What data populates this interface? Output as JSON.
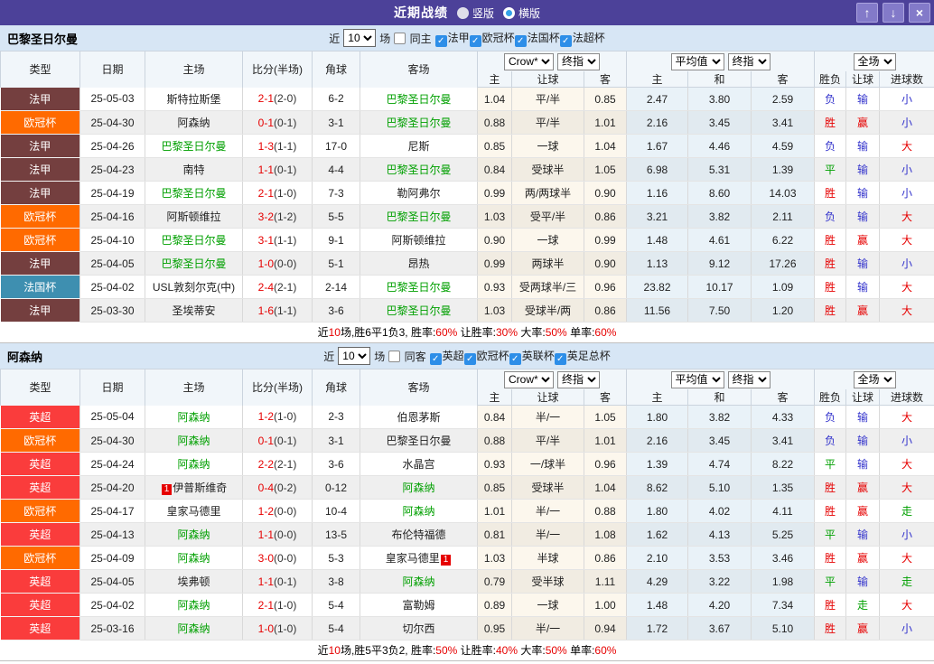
{
  "titlebar": {
    "title": "近期战绩",
    "radios": [
      {
        "label": "竖版",
        "style": "filled"
      },
      {
        "label": "横版",
        "style": "ring"
      }
    ],
    "buttons": {
      "up": "↑",
      "down": "↓",
      "close": "×"
    }
  },
  "table_header": {
    "main": [
      "类型",
      "日期",
      "主场",
      "比分(半场)",
      "角球",
      "客场"
    ],
    "sub": [
      "主",
      "让球",
      "客",
      "主",
      "和",
      "客",
      "胜负",
      "让球",
      "进球数"
    ],
    "selects": {
      "asia_source": "Crow*",
      "asia_index": "终指",
      "euro_source": "平均值",
      "euro_index": "终指",
      "scope": "全场"
    }
  },
  "league_colors": {
    "法甲": "#743F3F",
    "欧冠杯": "#FF6A00",
    "法国杯": "#3E8FB0",
    "英超": "#FA3C3C"
  },
  "outcome_colors": {
    "胜": "#E60000",
    "平": "#00A000",
    "负": "#3333CC",
    "赢": "#E60000",
    "输": "#3333CC",
    "走": "#00A000",
    "大": "#E60000",
    "小": "#3333CC"
  },
  "sections": [
    {
      "team": "巴黎圣日尔曼",
      "filter": {
        "near": "近",
        "count": "10",
        "unit": "场",
        "same": {
          "label": "同主",
          "checked": false
        },
        "leagues": [
          {
            "label": "法甲",
            "checked": true
          },
          {
            "label": "欧冠杯",
            "checked": true
          },
          {
            "label": "法国杯",
            "checked": true
          },
          {
            "label": "法超杯",
            "checked": true
          }
        ]
      },
      "rows": [
        {
          "league": "法甲",
          "date": "25-05-03",
          "home": "斯特拉斯堡",
          "home_team": false,
          "score": "2-1",
          "half": "(2-0)",
          "corner": "6-2",
          "away": "巴黎圣日尔曼",
          "away_team": true,
          "odds": [
            "1.04",
            "平/半",
            "0.85",
            "2.47",
            "3.80",
            "2.59"
          ],
          "result": "负",
          "let": "输",
          "goal": "小"
        },
        {
          "league": "欧冠杯",
          "date": "25-04-30",
          "home": "阿森纳",
          "home_team": false,
          "score": "0-1",
          "half": "(0-1)",
          "corner": "3-1",
          "away": "巴黎圣日尔曼",
          "away_team": true,
          "odds": [
            "0.88",
            "平/半",
            "1.01",
            "2.16",
            "3.45",
            "3.41"
          ],
          "result": "胜",
          "let": "赢",
          "goal": "小"
        },
        {
          "league": "法甲",
          "date": "25-04-26",
          "home": "巴黎圣日尔曼",
          "home_team": true,
          "score": "1-3",
          "half": "(1-1)",
          "corner": "17-0",
          "away": "尼斯",
          "away_team": false,
          "odds": [
            "0.85",
            "一球",
            "1.04",
            "1.67",
            "4.46",
            "4.59"
          ],
          "result": "负",
          "let": "输",
          "goal": "大"
        },
        {
          "league": "法甲",
          "date": "25-04-23",
          "home": "南特",
          "home_team": false,
          "score": "1-1",
          "half": "(0-1)",
          "corner": "4-4",
          "away": "巴黎圣日尔曼",
          "away_team": true,
          "odds": [
            "0.84",
            "受球半",
            "1.05",
            "6.98",
            "5.31",
            "1.39"
          ],
          "result": "平",
          "let": "输",
          "goal": "小"
        },
        {
          "league": "法甲",
          "date": "25-04-19",
          "home": "巴黎圣日尔曼",
          "home_team": true,
          "score": "2-1",
          "half": "(1-0)",
          "corner": "7-3",
          "away": "勒阿弗尔",
          "away_team": false,
          "odds": [
            "0.99",
            "两/两球半",
            "0.90",
            "1.16",
            "8.60",
            "14.03"
          ],
          "result": "胜",
          "let": "输",
          "goal": "小"
        },
        {
          "league": "欧冠杯",
          "date": "25-04-16",
          "home": "阿斯顿维拉",
          "home_team": false,
          "score": "3-2",
          "half": "(1-2)",
          "corner": "5-5",
          "away": "巴黎圣日尔曼",
          "away_team": true,
          "odds": [
            "1.03",
            "受平/半",
            "0.86",
            "3.21",
            "3.82",
            "2.11"
          ],
          "result": "负",
          "let": "输",
          "goal": "大"
        },
        {
          "league": "欧冠杯",
          "date": "25-04-10",
          "home": "巴黎圣日尔曼",
          "home_team": true,
          "score": "3-1",
          "half": "(1-1)",
          "corner": "9-1",
          "away": "阿斯顿维拉",
          "away_team": false,
          "odds": [
            "0.90",
            "一球",
            "0.99",
            "1.48",
            "4.61",
            "6.22"
          ],
          "result": "胜",
          "let": "赢",
          "goal": "大"
        },
        {
          "league": "法甲",
          "date": "25-04-05",
          "home": "巴黎圣日尔曼",
          "home_team": true,
          "score": "1-0",
          "half": "(0-0)",
          "corner": "5-1",
          "away": "昂热",
          "away_team": false,
          "odds": [
            "0.99",
            "两球半",
            "0.90",
            "1.13",
            "9.12",
            "17.26"
          ],
          "result": "胜",
          "let": "输",
          "goal": "小"
        },
        {
          "league": "法国杯",
          "date": "25-04-02",
          "home": "USL敦刻尔克(中)",
          "home_team": false,
          "score": "2-4",
          "half": "(2-1)",
          "corner": "2-14",
          "away": "巴黎圣日尔曼",
          "away_team": true,
          "odds": [
            "0.93",
            "受两球半/三",
            "0.96",
            "23.82",
            "10.17",
            "1.09"
          ],
          "result": "胜",
          "let": "输",
          "goal": "大"
        },
        {
          "league": "法甲",
          "date": "25-03-30",
          "home": "圣埃蒂安",
          "home_team": false,
          "score": "1-6",
          "half": "(1-1)",
          "corner": "3-6",
          "away": "巴黎圣日尔曼",
          "away_team": true,
          "odds": [
            "1.03",
            "受球半/两",
            "0.86",
            "11.56",
            "7.50",
            "1.20"
          ],
          "result": "胜",
          "let": "赢",
          "goal": "大"
        }
      ],
      "summary_segments": [
        {
          "t": "近",
          "red": false
        },
        {
          "t": "10",
          "red": true
        },
        {
          "t": "场,胜6平1负3, 胜率:",
          "red": false
        },
        {
          "t": "60%",
          "red": true
        },
        {
          "t": " 让胜率:",
          "red": false
        },
        {
          "t": "30%",
          "red": true
        },
        {
          "t": " 大率:",
          "red": false
        },
        {
          "t": "50%",
          "red": true
        },
        {
          "t": " 单率:",
          "red": false
        },
        {
          "t": "60%",
          "red": true
        }
      ]
    },
    {
      "team": "阿森纳",
      "filter": {
        "near": "近",
        "count": "10",
        "unit": "场",
        "same": {
          "label": "同客",
          "checked": false
        },
        "leagues": [
          {
            "label": "英超",
            "checked": true
          },
          {
            "label": "欧冠杯",
            "checked": true
          },
          {
            "label": "英联杯",
            "checked": true
          },
          {
            "label": "英足总杯",
            "checked": true
          }
        ]
      },
      "rows": [
        {
          "league": "英超",
          "date": "25-05-04",
          "home": "阿森纳",
          "home_team": true,
          "score": "1-2",
          "half": "(1-0)",
          "corner": "2-3",
          "away": "伯恩茅斯",
          "away_team": false,
          "odds": [
            "0.84",
            "半/一",
            "1.05",
            "1.80",
            "3.82",
            "4.33"
          ],
          "result": "负",
          "let": "输",
          "goal": "大"
        },
        {
          "league": "欧冠杯",
          "date": "25-04-30",
          "home": "阿森纳",
          "home_team": true,
          "score": "0-1",
          "half": "(0-1)",
          "corner": "3-1",
          "away": "巴黎圣日尔曼",
          "away_team": false,
          "odds": [
            "0.88",
            "平/半",
            "1.01",
            "2.16",
            "3.45",
            "3.41"
          ],
          "result": "负",
          "let": "输",
          "goal": "小"
        },
        {
          "league": "英超",
          "date": "25-04-24",
          "home": "阿森纳",
          "home_team": true,
          "score": "2-2",
          "half": "(2-1)",
          "corner": "3-6",
          "away": "水晶宫",
          "away_team": false,
          "odds": [
            "0.93",
            "一/球半",
            "0.96",
            "1.39",
            "4.74",
            "8.22"
          ],
          "result": "平",
          "let": "输",
          "goal": "大"
        },
        {
          "league": "英超",
          "date": "25-04-20",
          "home": "伊普斯维奇",
          "home_team": false,
          "home_badge": "1",
          "score": "0-4",
          "half": "(0-2)",
          "corner": "0-12",
          "away": "阿森纳",
          "away_team": true,
          "odds": [
            "0.85",
            "受球半",
            "1.04",
            "8.62",
            "5.10",
            "1.35"
          ],
          "result": "胜",
          "let": "赢",
          "goal": "大"
        },
        {
          "league": "欧冠杯",
          "date": "25-04-17",
          "home": "皇家马德里",
          "home_team": false,
          "score": "1-2",
          "half": "(0-0)",
          "corner": "10-4",
          "away": "阿森纳",
          "away_team": true,
          "odds": [
            "1.01",
            "半/一",
            "0.88",
            "1.80",
            "4.02",
            "4.11"
          ],
          "result": "胜",
          "let": "赢",
          "goal": "走"
        },
        {
          "league": "英超",
          "date": "25-04-13",
          "home": "阿森纳",
          "home_team": true,
          "score": "1-1",
          "half": "(0-0)",
          "corner": "13-5",
          "away": "布伦特福德",
          "away_team": false,
          "odds": [
            "0.81",
            "半/一",
            "1.08",
            "1.62",
            "4.13",
            "5.25"
          ],
          "result": "平",
          "let": "输",
          "goal": "小"
        },
        {
          "league": "欧冠杯",
          "date": "25-04-09",
          "home": "阿森纳",
          "home_team": true,
          "score": "3-0",
          "half": "(0-0)",
          "corner": "5-3",
          "away": "皇家马德里",
          "away_team": false,
          "away_badge": "1",
          "odds": [
            "1.03",
            "半球",
            "0.86",
            "2.10",
            "3.53",
            "3.46"
          ],
          "result": "胜",
          "let": "赢",
          "goal": "大"
        },
        {
          "league": "英超",
          "date": "25-04-05",
          "home": "埃弗顿",
          "home_team": false,
          "score": "1-1",
          "half": "(0-1)",
          "corner": "3-8",
          "away": "阿森纳",
          "away_team": true,
          "odds": [
            "0.79",
            "受半球",
            "1.11",
            "4.29",
            "3.22",
            "1.98"
          ],
          "result": "平",
          "let": "输",
          "goal": "走"
        },
        {
          "league": "英超",
          "date": "25-04-02",
          "home": "阿森纳",
          "home_team": true,
          "score": "2-1",
          "half": "(1-0)",
          "corner": "5-4",
          "away": "富勒姆",
          "away_team": false,
          "odds": [
            "0.89",
            "一球",
            "1.00",
            "1.48",
            "4.20",
            "7.34"
          ],
          "result": "胜",
          "let": "走",
          "goal": "大"
        },
        {
          "league": "英超",
          "date": "25-03-16",
          "home": "阿森纳",
          "home_team": true,
          "score": "1-0",
          "half": "(1-0)",
          "corner": "5-4",
          "away": "切尔西",
          "away_team": false,
          "odds": [
            "0.95",
            "半/一",
            "0.94",
            "1.72",
            "3.67",
            "5.10"
          ],
          "result": "胜",
          "let": "赢",
          "goal": "小"
        }
      ],
      "summary_segments": [
        {
          "t": "近",
          "red": false
        },
        {
          "t": "10",
          "red": true
        },
        {
          "t": "场,胜5平3负2, 胜率:",
          "red": false
        },
        {
          "t": "50%",
          "red": true
        },
        {
          "t": " 让胜率:",
          "red": false
        },
        {
          "t": "40%",
          "red": true
        },
        {
          "t": " 大率:",
          "red": false
        },
        {
          "t": "50%",
          "red": true
        },
        {
          "t": " 单率:",
          "red": false
        },
        {
          "t": "60%",
          "red": true
        }
      ]
    }
  ]
}
